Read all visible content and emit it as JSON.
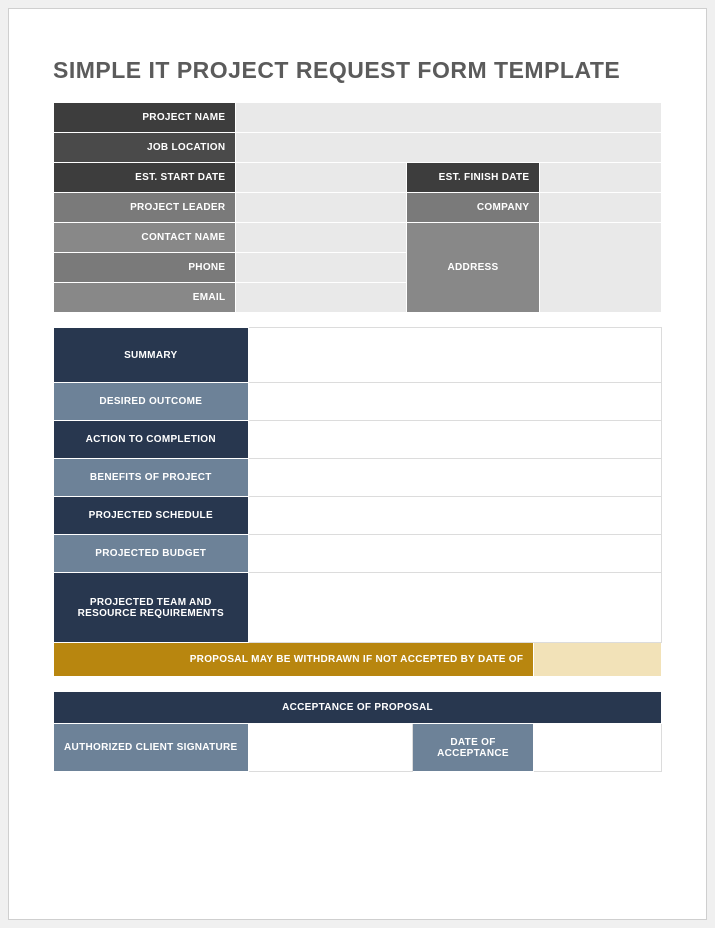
{
  "title": "SIMPLE IT PROJECT REQUEST FORM TEMPLATE",
  "section1": {
    "project_name": "PROJECT NAME",
    "job_location": "JOB LOCATION",
    "est_start_date": "EST. START DATE",
    "est_finish_date": "EST. FINISH DATE",
    "project_leader": "PROJECT LEADER",
    "company": "COMPANY",
    "contact_name": "CONTACT NAME",
    "address": "ADDRESS",
    "phone": "PHONE",
    "email": "EMAIL"
  },
  "section2": {
    "summary": "SUMMARY",
    "desired_outcome": "DESIRED OUTCOME",
    "action_to_completion": "ACTION TO COMPLETION",
    "benefits": "BENEFITS OF PROJECT",
    "projected_schedule": "PROJECTED SCHEDULE",
    "projected_budget": "PROJECTED BUDGET",
    "team_resource": "PROJECTED TEAM AND RESOURCE REQUIREMENTS",
    "withdrawal_notice": "PROPOSAL MAY BE WITHDRAWN IF NOT ACCEPTED BY DATE OF"
  },
  "section3": {
    "header": "ACCEPTANCE OF PROPOSAL",
    "signature": "AUTHORIZED CLIENT SIGNATURE",
    "date": "DATE OF ACCEPTANCE"
  }
}
